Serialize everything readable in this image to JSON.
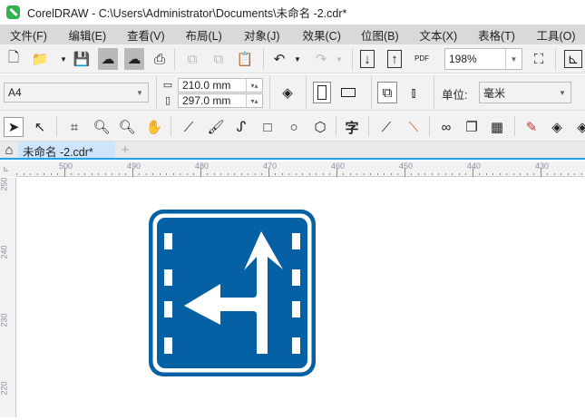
{
  "window": {
    "title": "CorelDRAW - C:\\Users\\Administrator\\Documents\\未命名 -2.cdr*"
  },
  "menu": [
    "文件(F)",
    "编辑(E)",
    "查看(V)",
    "布局(L)",
    "对象(J)",
    "效果(C)",
    "位图(B)",
    "文本(X)",
    "表格(T)",
    "工具(O)"
  ],
  "toolbar": {
    "zoom": "198%",
    "pdf_label": "PDF"
  },
  "property_bar": {
    "page_size": "A4",
    "width": "210.0 mm",
    "height": "297.0 mm",
    "unit_label": "单位:",
    "unit": "毫米"
  },
  "tools": {
    "text_tool": "字"
  },
  "tabs": {
    "document": "未命名 -2.cdr*",
    "add": "+"
  },
  "ruler": {
    "horizontal": [
      "500",
      "490",
      "480",
      "470",
      "460",
      "450",
      "440",
      "430"
    ],
    "vertical": [
      "250",
      "240",
      "230",
      "220"
    ]
  },
  "sign": {
    "blue": "#0560a4",
    "white": "#ffffff"
  }
}
